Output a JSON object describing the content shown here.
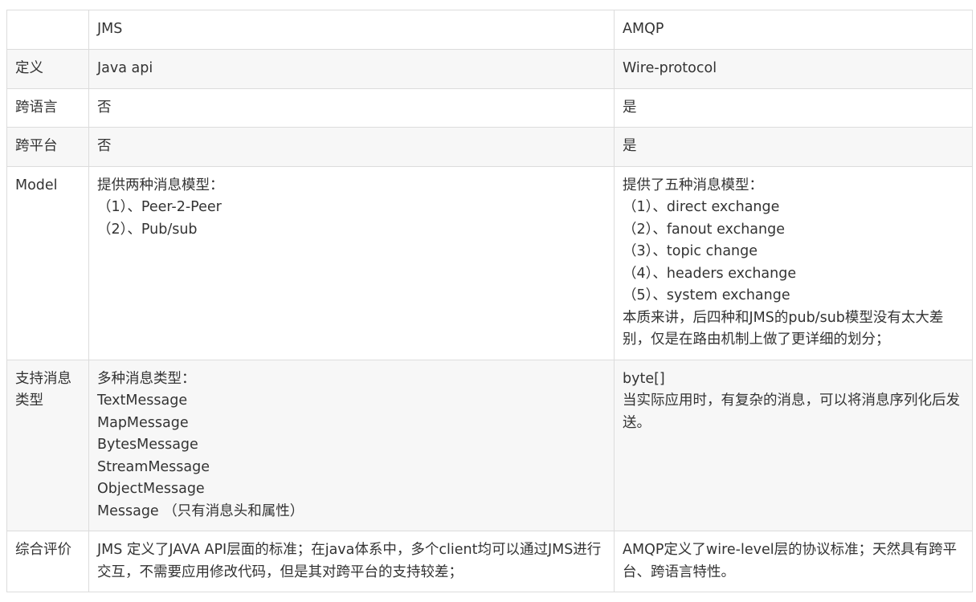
{
  "table": {
    "header": {
      "c1": "",
      "c2": "JMS",
      "c3": "AMQP"
    },
    "rows": [
      {
        "label": "定义",
        "jms": "Java api",
        "amqp": "Wire-protocol"
      },
      {
        "label": "跨语言",
        "jms": "否",
        "amqp": "是"
      },
      {
        "label": "跨平台",
        "jms": "否",
        "amqp": "是"
      },
      {
        "label": "Model",
        "jms": [
          "提供两种消息模型：",
          "（1）、Peer-2-Peer",
          "（2）、Pub/sub"
        ],
        "amqp": [
          "提供了五种消息模型：",
          "（1）、direct exchange",
          "（2）、fanout exchange",
          "（3）、topic change",
          "（4）、headers exchange",
          "（5）、system exchange",
          "本质来讲，后四种和JMS的pub/sub模型没有太大差别，仅是在路由机制上做了更详细的划分；"
        ]
      },
      {
        "label": "支持消息类型",
        "jms": [
          "多种消息类型：",
          "TextMessage",
          "MapMessage",
          "BytesMessage",
          "StreamMessage",
          "ObjectMessage",
          "Message （只有消息头和属性）"
        ],
        "amqp": [
          "byte[]",
          "当实际应用时，有复杂的消息，可以将消息序列化后发送。"
        ]
      },
      {
        "label": "综合评价",
        "jms": "JMS 定义了JAVA API层面的标准；在java体系中，多个client均可以通过JMS进行交互，不需要应用修改代码，但是其对跨平台的支持较差；",
        "amqp": "AMQP定义了wire-level层的协议标准；天然具有跨平台、跨语言特性。"
      }
    ]
  }
}
